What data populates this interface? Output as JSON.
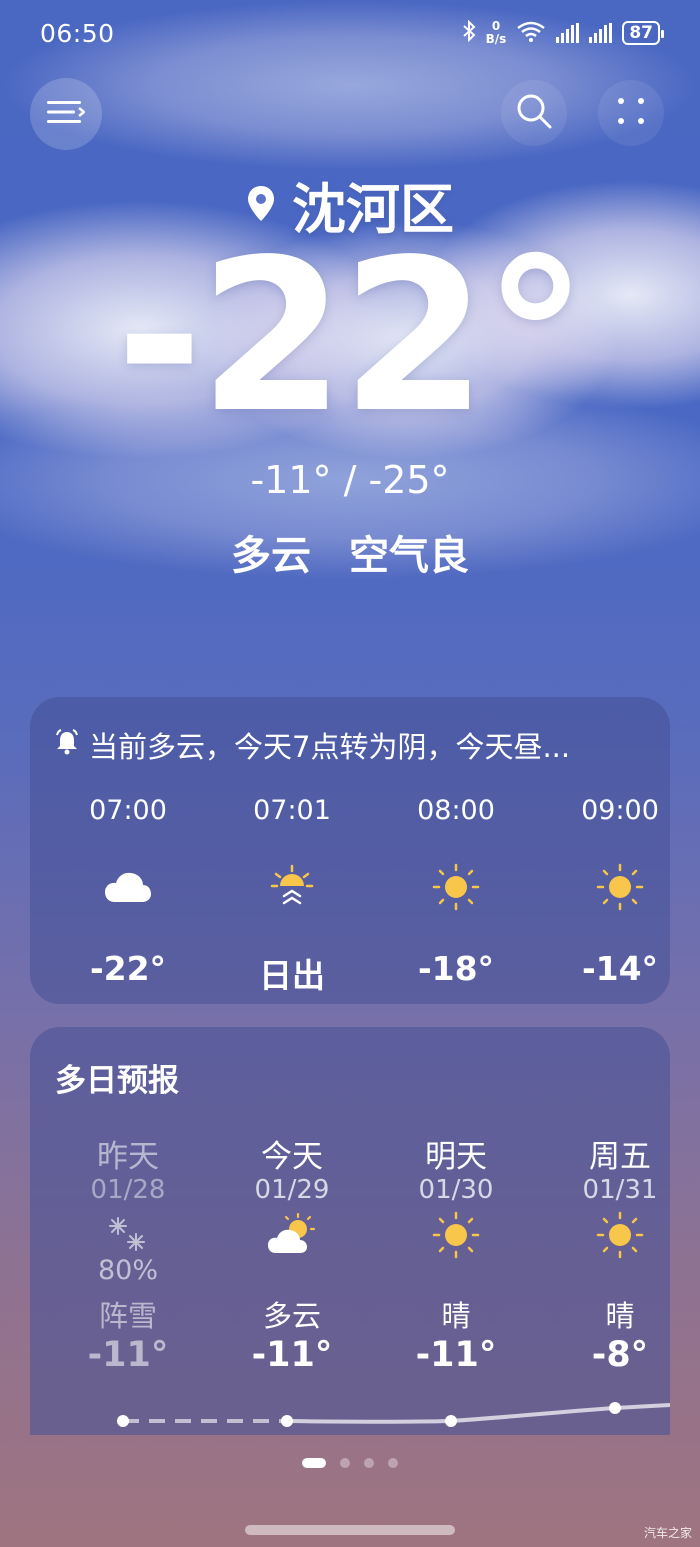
{
  "status_bar": {
    "time": "06:50",
    "net_speed_top": "0",
    "net_speed_bottom": "B/s",
    "battery": "87"
  },
  "header": {
    "location": "沈河区",
    "temperature": "-22°",
    "hi_lo": "-11° / -25°",
    "condition": "多云",
    "air_quality": "空气良"
  },
  "hourly": {
    "alert_text": "当前多云，今天7点转为阴，今天昼...",
    "items": [
      {
        "time": "07:00",
        "icon": "cloud-icon",
        "value": "-22°"
      },
      {
        "time": "07:01",
        "icon": "sunrise-icon",
        "value": "日出"
      },
      {
        "time": "08:00",
        "icon": "sun-icon",
        "value": "-18°"
      },
      {
        "time": "09:00",
        "icon": "sun-icon",
        "value": "-14°"
      }
    ]
  },
  "daily": {
    "title": "多日预报",
    "items": [
      {
        "day": "昨天",
        "date": "01/28",
        "icon": "snow-icon",
        "precip": "80%",
        "desc": "阵雪",
        "high": "-11°"
      },
      {
        "day": "今天",
        "date": "01/29",
        "icon": "partly-cloudy-icon",
        "precip": "",
        "desc": "多云",
        "high": "-11°"
      },
      {
        "day": "明天",
        "date": "01/30",
        "icon": "sun-icon",
        "precip": "",
        "desc": "晴",
        "high": "-11°"
      },
      {
        "day": "周五",
        "date": "01/31",
        "icon": "sun-icon",
        "precip": "",
        "desc": "晴",
        "high": "-8°"
      }
    ]
  },
  "watermark": "汽车之家",
  "colors": {
    "sun": "#f7c64a",
    "card": "#4a5296",
    "sky_top": "#4a67c2",
    "sky_bottom": "#9f7480"
  }
}
